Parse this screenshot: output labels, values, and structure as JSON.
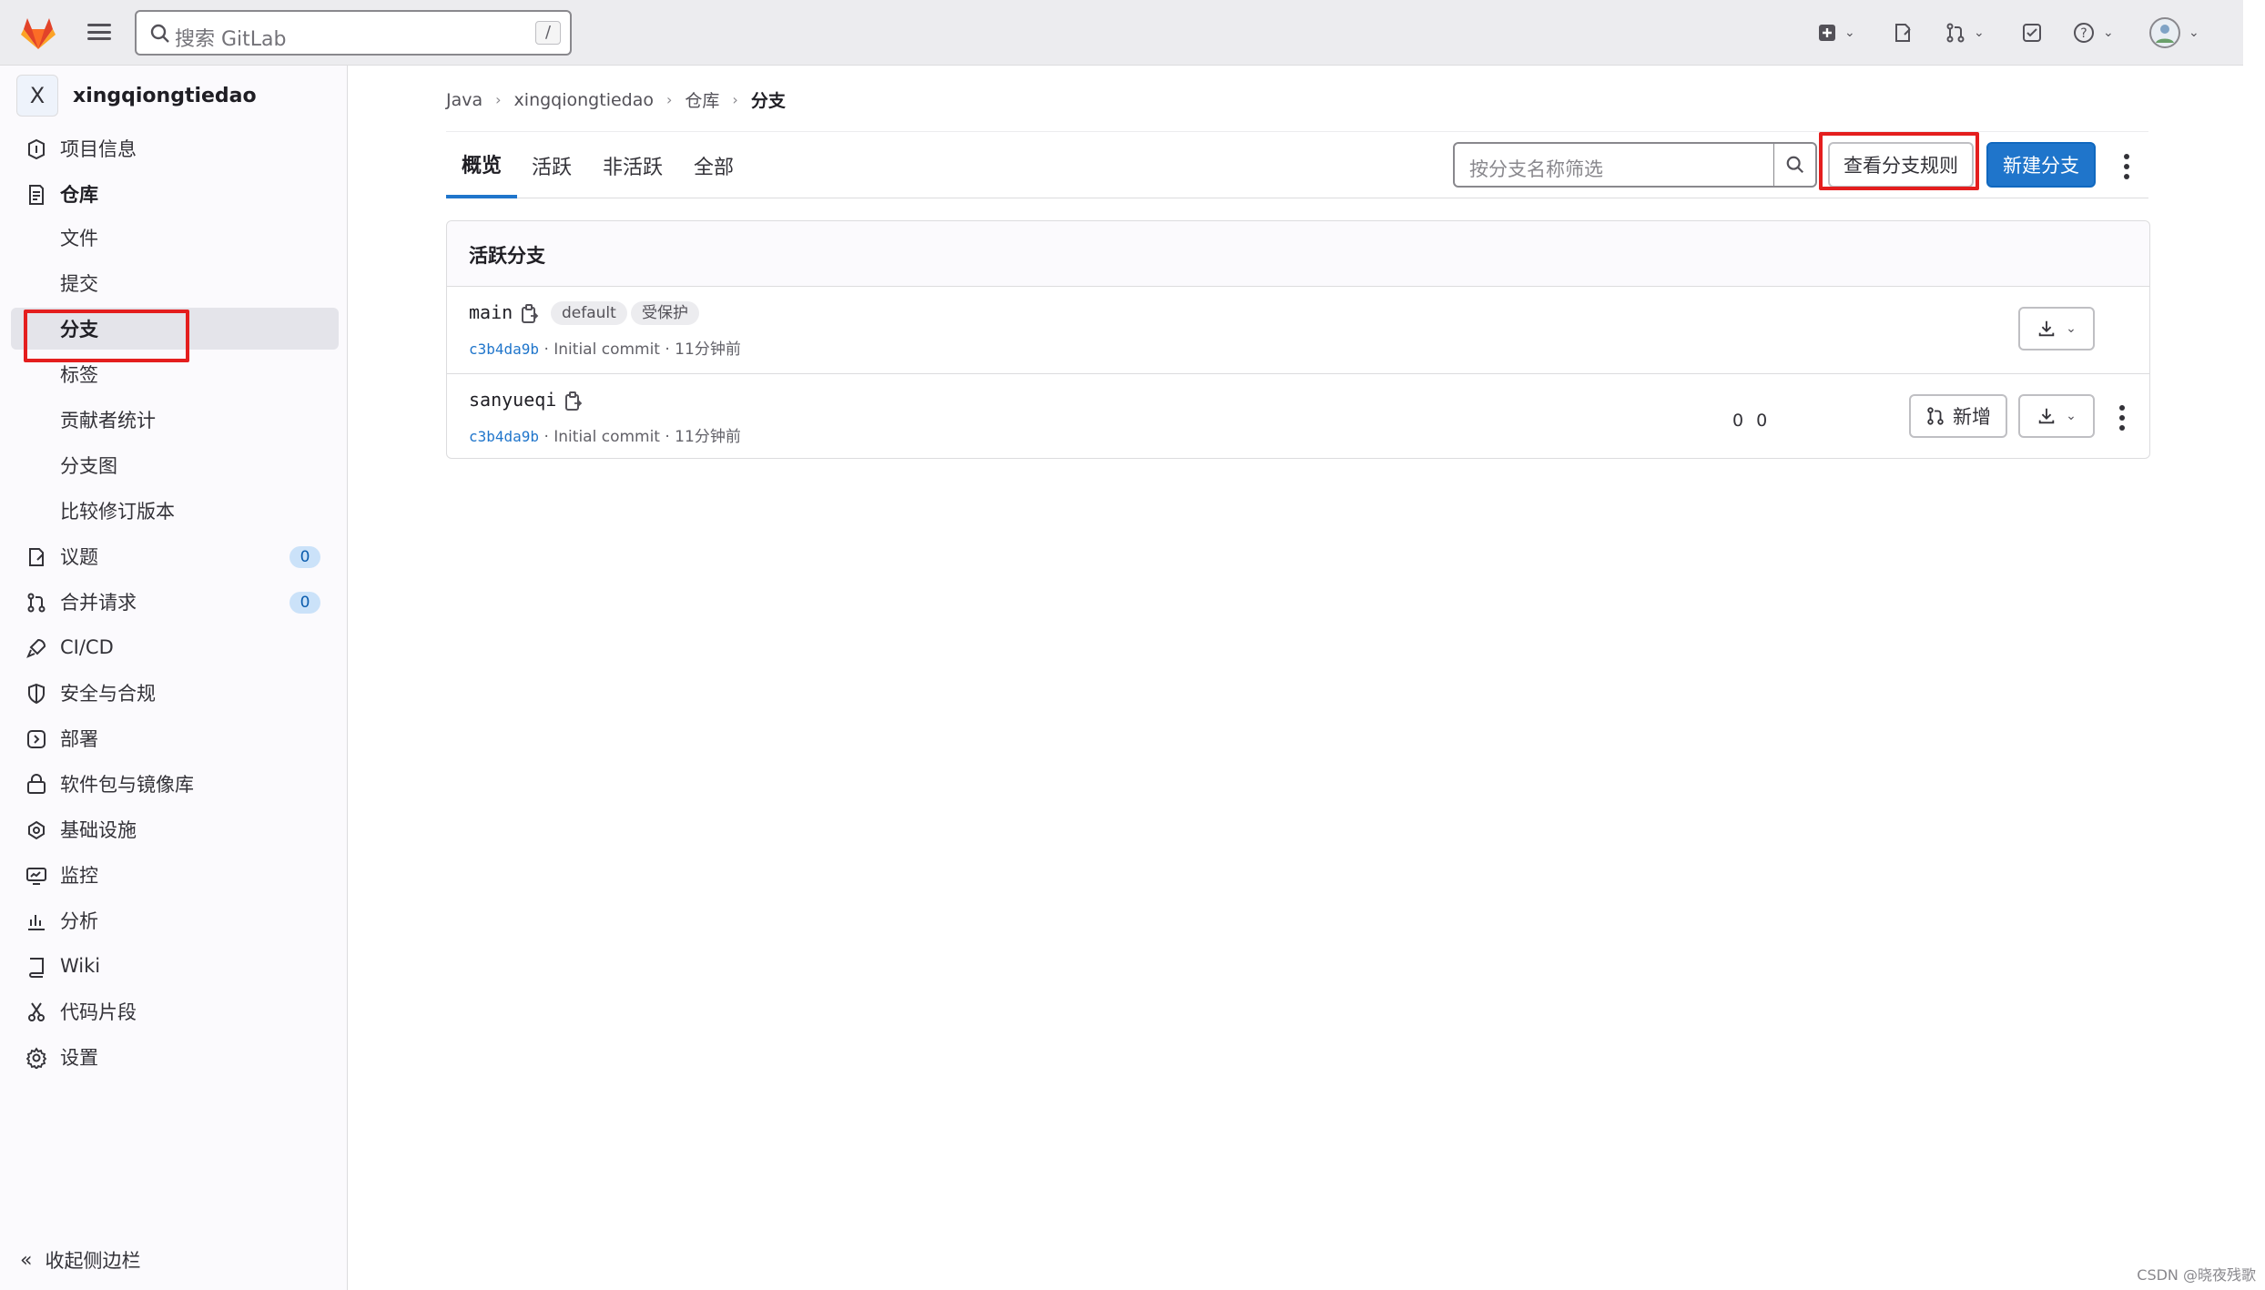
{
  "topbar": {
    "search_placeholder": "搜索 GitLab",
    "search_shortcut": "/"
  },
  "sidebar": {
    "project_initial": "X",
    "project_name": "xingqiongtiedao",
    "items": [
      {
        "label": "项目信息",
        "icon": "info-icon"
      },
      {
        "label": "仓库",
        "icon": "repository-icon"
      },
      {
        "label": "文件"
      },
      {
        "label": "提交"
      },
      {
        "label": "分支"
      },
      {
        "label": "标签"
      },
      {
        "label": "贡献者统计"
      },
      {
        "label": "分支图"
      },
      {
        "label": "比较修订版本"
      },
      {
        "label": "议题",
        "icon": "issues-icon",
        "count": "0"
      },
      {
        "label": "合并请求",
        "icon": "merge-request-icon",
        "count": "0"
      },
      {
        "label": "CI/CD",
        "icon": "rocket-icon"
      },
      {
        "label": "安全与合规",
        "icon": "shield-icon"
      },
      {
        "label": "部署",
        "icon": "deployments-icon"
      },
      {
        "label": "软件包与镜像库",
        "icon": "package-icon"
      },
      {
        "label": "基础设施",
        "icon": "cloud-gear-icon"
      },
      {
        "label": "监控",
        "icon": "monitor-icon"
      },
      {
        "label": "分析",
        "icon": "chart-icon"
      },
      {
        "label": "Wiki",
        "icon": "book-icon"
      },
      {
        "label": "代码片段",
        "icon": "snippet-icon"
      },
      {
        "label": "设置",
        "icon": "settings-icon"
      }
    ],
    "collapse_label": "收起侧边栏"
  },
  "breadcrumb": [
    "Java",
    "xingqiongtiedao",
    "仓库",
    "分支"
  ],
  "tabs": [
    "概览",
    "活跃",
    "非活跃",
    "全部"
  ],
  "filter_placeholder": "按分支名称筛选",
  "buttons": {
    "view_rules": "查看分支规则",
    "new_branch": "新建分支"
  },
  "card": {
    "title": "活跃分支",
    "branches": [
      {
        "name": "main",
        "badges": [
          "default",
          "受保护"
        ],
        "sha": "c3b4da9b",
        "meta": " · Initial commit · 11分钟前",
        "divergence": ""
      },
      {
        "name": "sanyueqi",
        "badges": [],
        "sha": "c3b4da9b",
        "meta": " · Initial commit · 11分钟前",
        "divergence": "0 0",
        "mr_button": "新增"
      }
    ]
  },
  "watermark": "CSDN @晓夜残歌",
  "colors": {
    "primary": "#1f75cb",
    "highlight": "#e41e1e"
  }
}
